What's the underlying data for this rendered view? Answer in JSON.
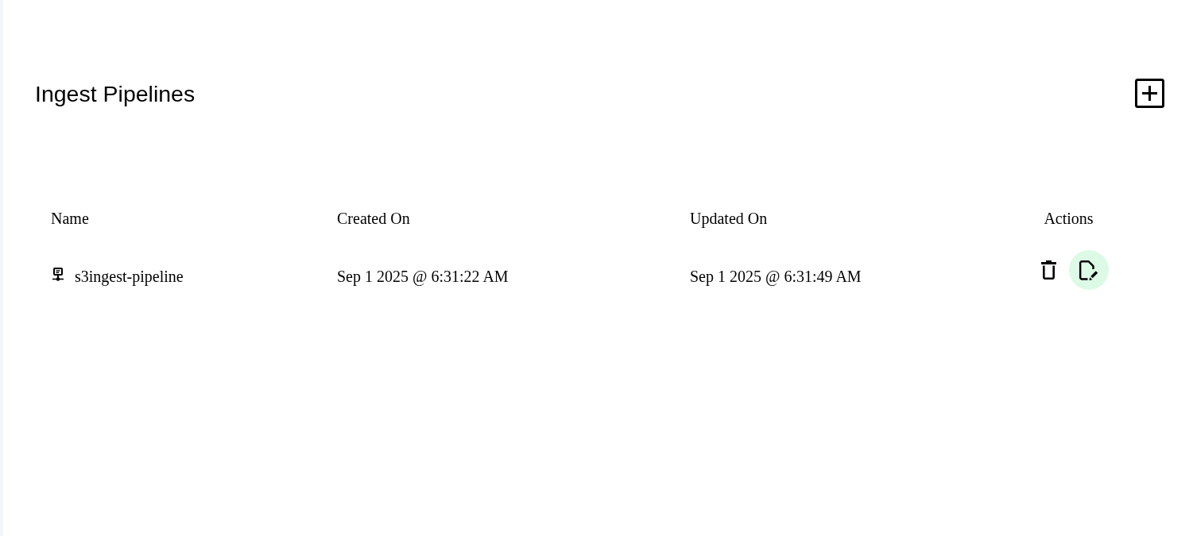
{
  "page": {
    "title": "Ingest Pipelines"
  },
  "table": {
    "columns": [
      "Name",
      "Created On",
      "Updated On",
      "Actions"
    ],
    "rows": [
      {
        "name": "s3ingest-pipeline",
        "created_on": "Sep 1 2025 @ 6:31:22 AM",
        "updated_on": "Sep 1 2025 @ 6:31:49 AM"
      }
    ]
  }
}
